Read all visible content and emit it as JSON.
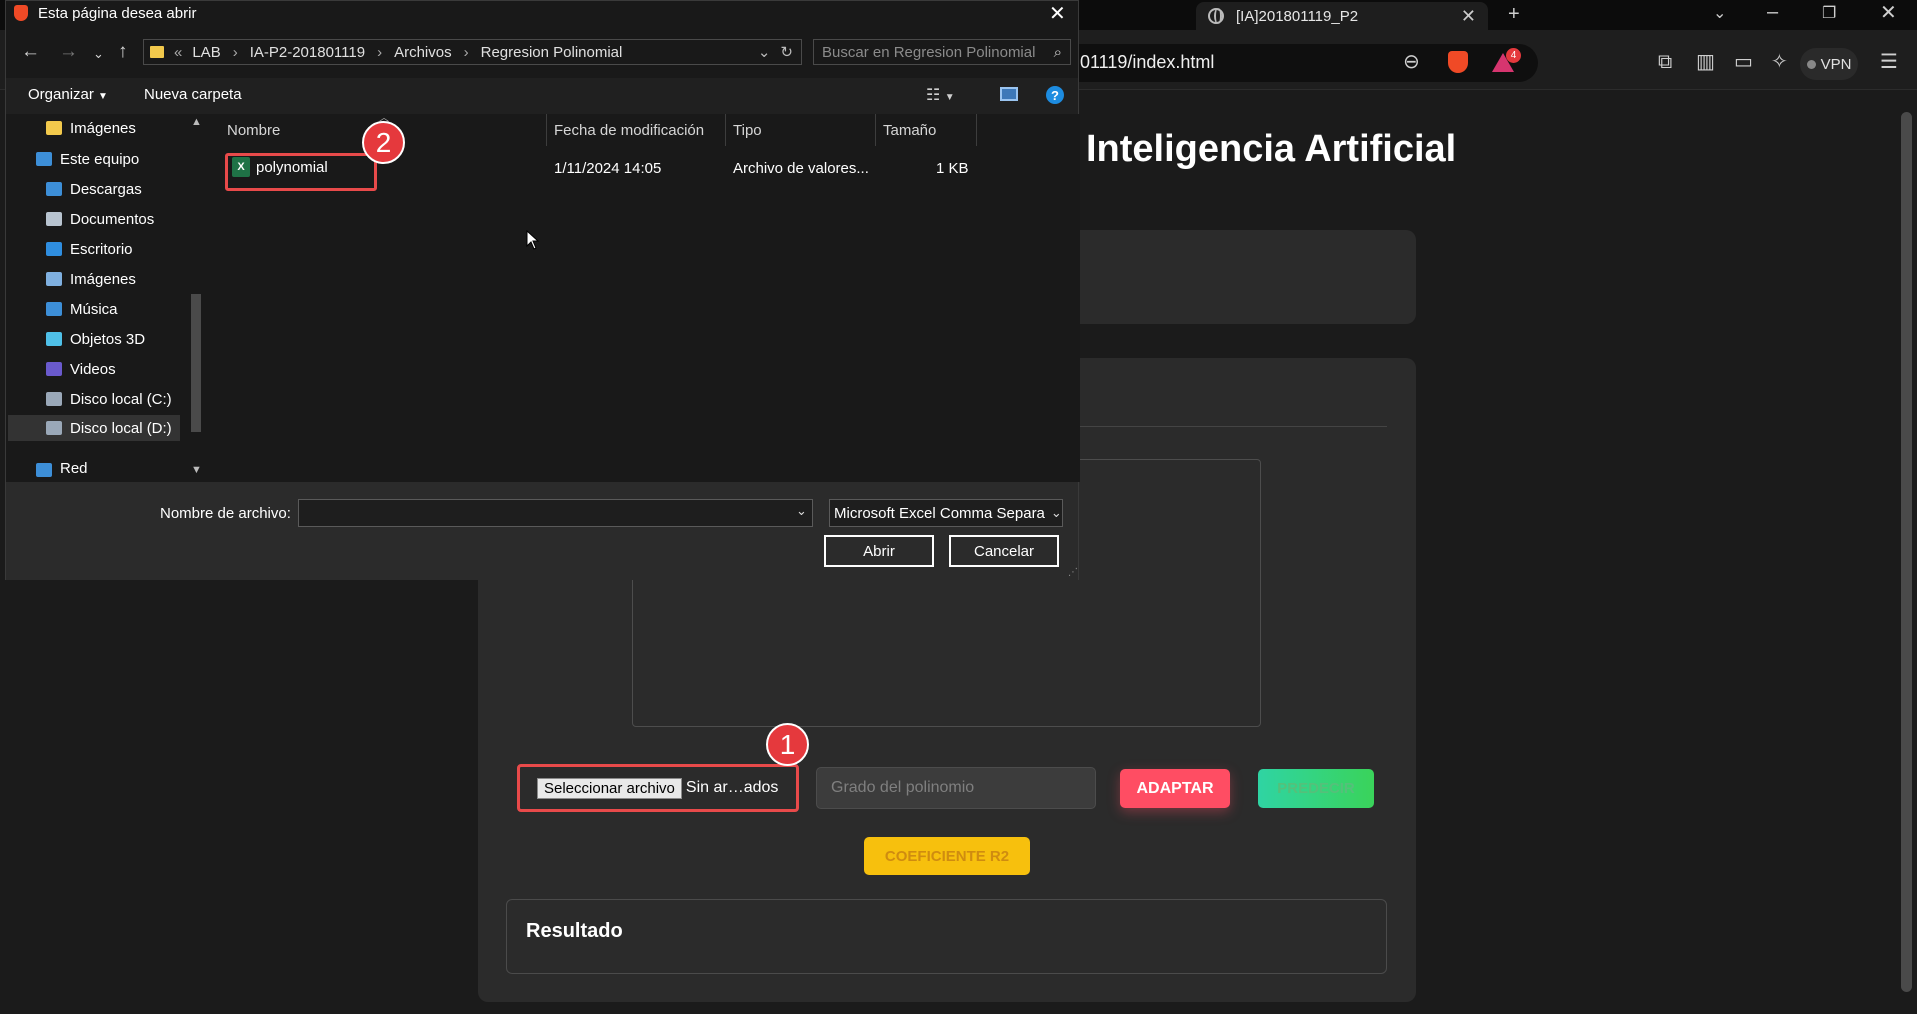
{
  "browser": {
    "tab_title": "[IA]201801119_P2",
    "address": "01119/index.html",
    "vpn_label": "VPN",
    "notification_count": "4"
  },
  "page": {
    "heading": "Inteligencia Artificial",
    "file_button_label": "Seleccionar archivo",
    "file_status": "Sin ar…ados",
    "degree_placeholder": "Grado del polinomio",
    "adapt_label": "ADAPTAR",
    "predict_label": "PREDECIR",
    "r2_label": "COEFICIENTE R2",
    "result_title": "Resultado"
  },
  "annotations": {
    "badge_1": "1",
    "badge_2": "2"
  },
  "dialog": {
    "title": "Esta página desea abrir",
    "breadcrumb": [
      "LAB",
      "IA-P2-201801119",
      "Archivos",
      "Regresion Polinomial"
    ],
    "breadcrumb_prefix": "«",
    "search_placeholder": "Buscar en Regresion Polinomial",
    "organize_label": "Organizar",
    "new_folder_label": "Nueva carpeta",
    "nav_items": [
      {
        "label": "Imágenes",
        "color": "#f2c94c"
      },
      {
        "label": "Este equipo",
        "color": "#3d8fd8"
      },
      {
        "label": "Descargas",
        "color": "#3d8fd8"
      },
      {
        "label": "Documentos",
        "color": "#b8c4d0"
      },
      {
        "label": "Escritorio",
        "color": "#2f8ee0"
      },
      {
        "label": "Imágenes",
        "color": "#7fb0e0"
      },
      {
        "label": "Música",
        "color": "#3d8fd8"
      },
      {
        "label": "Objetos 3D",
        "color": "#4fc0e8"
      },
      {
        "label": "Videos",
        "color": "#6a5acd"
      },
      {
        "label": "Disco local (C:)",
        "color": "#9aa8b8"
      },
      {
        "label": "Disco local (D:)",
        "color": "#9aa8b8"
      },
      {
        "label": "Red",
        "color": "#3d8fd8"
      }
    ],
    "columns": [
      "Nombre",
      "Fecha de modificación",
      "Tipo",
      "Tamaño"
    ],
    "files": [
      {
        "name": "polynomial",
        "modified": "1/11/2024 14:05",
        "type": "Archivo de valores...",
        "size": "1 KB"
      }
    ],
    "filename_label": "Nombre de archivo:",
    "filename_value": "",
    "filetype": "Microsoft Excel Comma Separa",
    "open_label": "Abrir",
    "cancel_label": "Cancelar"
  }
}
